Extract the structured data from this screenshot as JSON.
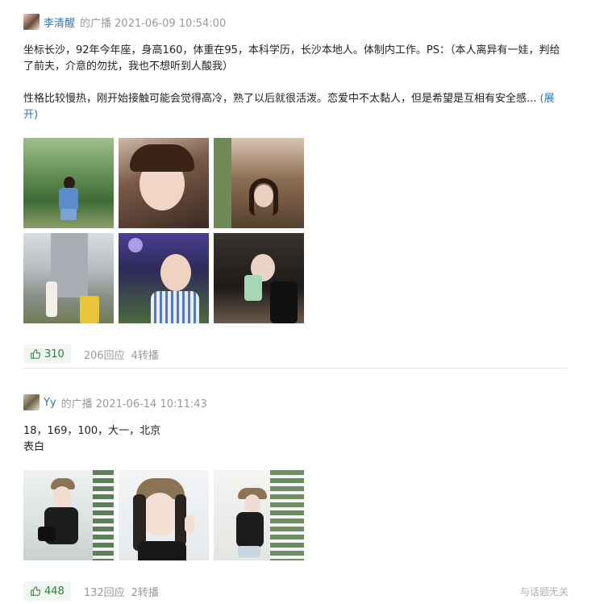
{
  "posts": [
    {
      "author": "李清醒",
      "meta": "的广播 2021-06-09 10:54:00",
      "paragraph1": "坐标长沙，92年今年座，身高160，体重在95，本科学历，长沙本地人。体制内工作。PS：（本人离异有一娃，判给了前夫，介意的勿扰，我也不想听到人酸我）",
      "paragraph2": "性格比较慢热，刚开始接触可能会觉得高冷，熟了以后就很活泼。恋爱中不太黏人，但是希望是互相有安全感...",
      "expand": "(展开)",
      "likes": "310",
      "replies": "206回应",
      "reshares": "4转播"
    },
    {
      "author": "Yy",
      "meta": "的广播 2021-06-14 10:11:43",
      "paragraph1": "18，169，100，大一，北京",
      "paragraph2": "表白",
      "likes": "448",
      "replies": "132回应",
      "reshares": "2转播",
      "unrelated": "与话题无关"
    }
  ],
  "icons": {
    "thumbs_up": "thumbs-up-icon",
    "avatar": "avatar"
  },
  "colors": {
    "link": "#3377aa",
    "like_bg": "#f0f7f0",
    "like_text": "#2e7f3f",
    "muted": "#999999"
  }
}
